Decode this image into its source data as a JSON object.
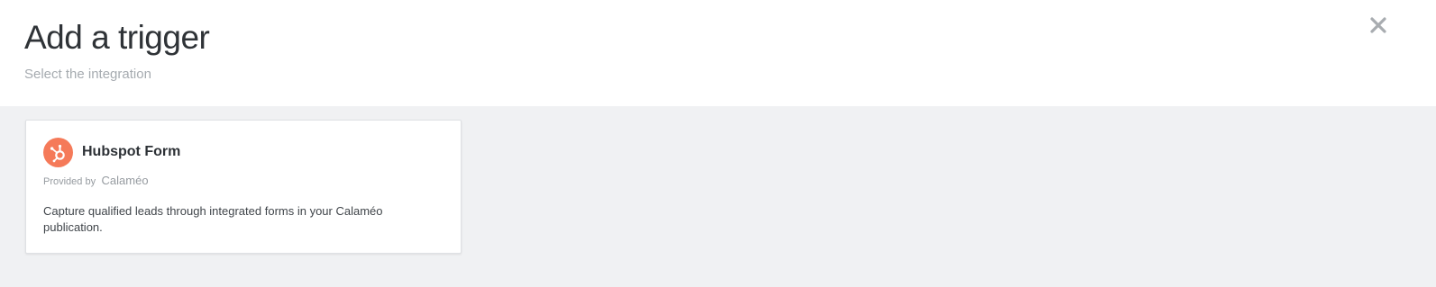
{
  "dialog": {
    "title": "Add a trigger",
    "subtitle": "Select the integration",
    "close_icon": "close-icon"
  },
  "integrations": [
    {
      "name": "Hubspot Form",
      "icon": "hubspot-icon",
      "icon_color": "#f57a59",
      "provided_by_label": "Provided by",
      "provider": "Calaméo",
      "description": "Capture qualified leads through integrated forms in your Calaméo publication."
    }
  ],
  "colors": {
    "content_background": "#f0f1f3",
    "hubspot_brand": "#f57a59"
  }
}
